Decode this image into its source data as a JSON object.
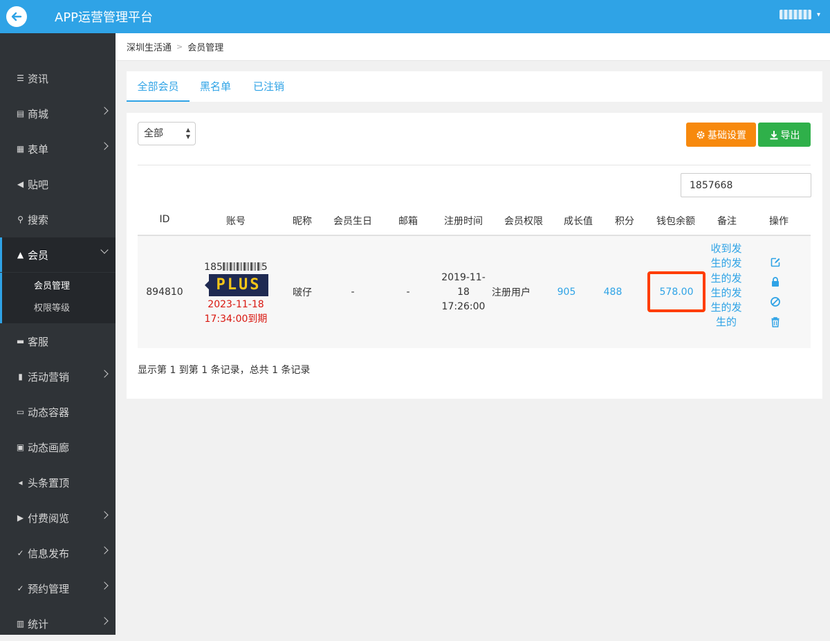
{
  "header": {
    "title": "APP运营管理平台",
    "caret": "▾"
  },
  "sidebar": {
    "items": [
      {
        "label": "资讯",
        "icon": "list-icon",
        "glyph": "☰"
      },
      {
        "label": "商城",
        "icon": "cart-icon",
        "glyph": "▤"
      },
      {
        "label": "表单",
        "icon": "form-icon",
        "glyph": "▦"
      },
      {
        "label": "贴吧",
        "icon": "megaphone-icon",
        "glyph": "◀"
      },
      {
        "label": "搜索",
        "icon": "search-icon",
        "glyph": "⚲"
      },
      {
        "label": "会员",
        "icon": "bell-icon",
        "glyph": "▲"
      },
      {
        "label": "客服",
        "icon": "chat-icon",
        "glyph": "▬"
      },
      {
        "label": "活动营销",
        "icon": "bookmark-icon",
        "glyph": "▮"
      },
      {
        "label": "动态容器",
        "icon": "inbox-icon",
        "glyph": "▭"
      },
      {
        "label": "动态画廊",
        "icon": "image-icon",
        "glyph": "▣"
      },
      {
        "label": "头条置顶",
        "icon": "volume-icon",
        "glyph": "◂"
      },
      {
        "label": "付费阅览",
        "icon": "play-icon",
        "glyph": "▶"
      },
      {
        "label": "信息发布",
        "icon": "check-icon",
        "glyph": "✓"
      },
      {
        "label": "预约管理",
        "icon": "check-icon",
        "glyph": "✓"
      },
      {
        "label": "统计",
        "icon": "bar-chart-icon",
        "glyph": "▥"
      }
    ],
    "sub_items": [
      {
        "label": "会员管理"
      },
      {
        "label": "权限等级"
      }
    ]
  },
  "breadcrumb": {
    "root": "深圳生活通",
    "sep": ">",
    "current": "会员管理"
  },
  "tabs": [
    {
      "label": "全部会员"
    },
    {
      "label": "黑名单"
    },
    {
      "label": "已注销"
    }
  ],
  "toolbar": {
    "filter_value": "全部",
    "settings_label": "基础设置",
    "export_label": "导出",
    "search_value": "1857668"
  },
  "table": {
    "headers": [
      "ID",
      "账号",
      "昵称",
      "会员生日",
      "邮箱",
      "注册时间",
      "会员权限",
      "成长值",
      "积分",
      "钱包余额",
      "备注",
      "操作"
    ],
    "row": {
      "id": "894810",
      "account_prefix": "185",
      "account_suffix": "5",
      "badge": "PLUS",
      "expiry_date": "2023-11-18",
      "expiry_time": "17:34:00到期",
      "nickname": "啵仔",
      "birthday": "-",
      "email": "-",
      "reg_line1": "2019-11-",
      "reg_line2": "18",
      "reg_line3": "17:26:00",
      "permission": "注册用户",
      "growth": "905",
      "points": "488",
      "wallet": "578.00",
      "remark": "收到发生的发生的发生的发生的发生的"
    },
    "footer": "显示第 1 到第 1 条记录，总共 1 条记录"
  },
  "colors": {
    "primary": "#2fa3e6",
    "orange": "#f7890d",
    "green": "#2fb04a",
    "highlight": "#ff3d00",
    "expiry": "#d9170f"
  }
}
